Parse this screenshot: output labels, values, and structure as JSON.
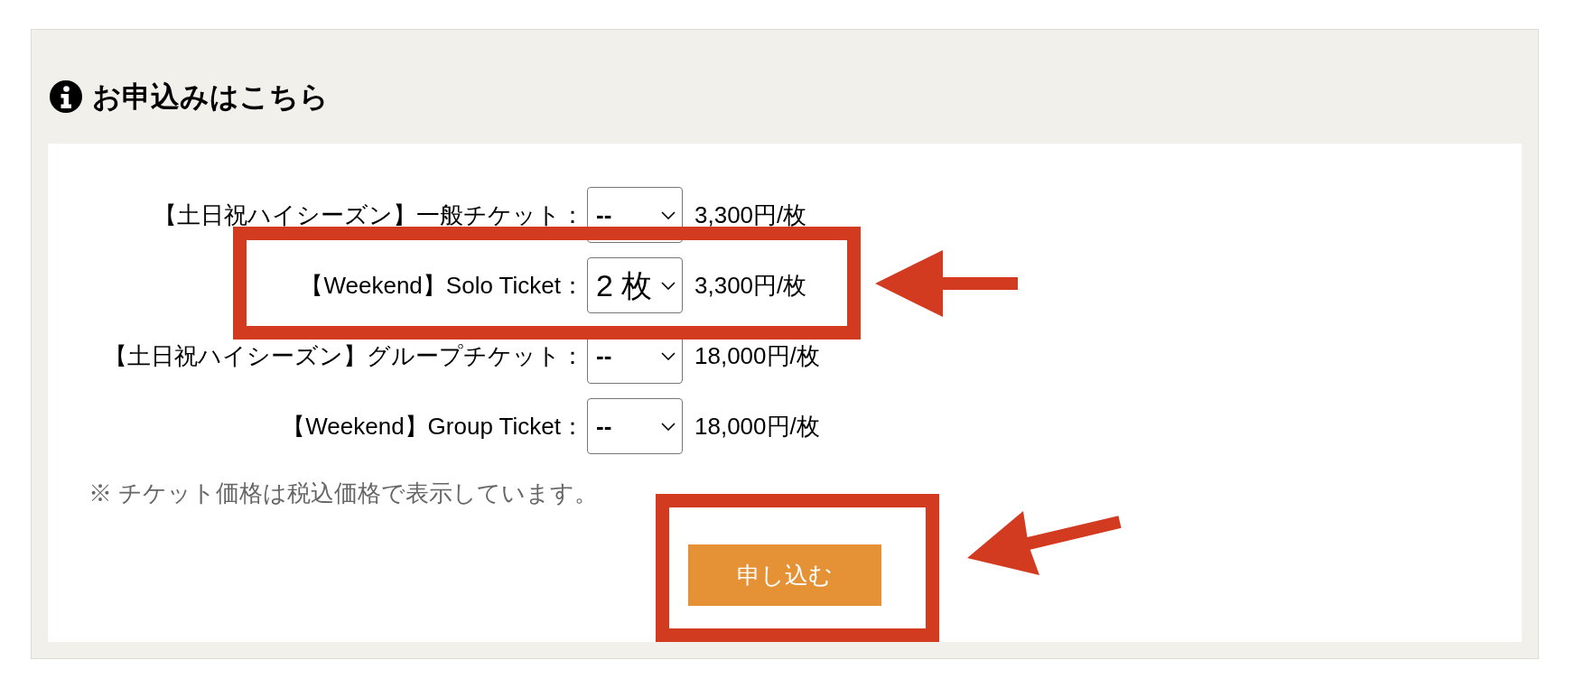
{
  "section": {
    "title": "お申込みはこちら"
  },
  "tickets": [
    {
      "label": "【土日祝ハイシーズン】一般チケット：",
      "quantity": {
        "kind": "placeholder",
        "value": "--"
      },
      "price": "3,300円/枚",
      "highlighted": false
    },
    {
      "label": "【Weekend】Solo Ticket：",
      "quantity": {
        "kind": "picked",
        "value": "2 枚"
      },
      "price": "3,300円/枚",
      "highlighted": true
    },
    {
      "label": "【土日祝ハイシーズン】グループチケット：",
      "quantity": {
        "kind": "placeholder",
        "value": "--"
      },
      "price": "18,000円/枚",
      "highlighted": false
    },
    {
      "label": "【Weekend】Group Ticket：",
      "quantity": {
        "kind": "placeholder",
        "value": "--"
      },
      "price": "18,000円/枚",
      "highlighted": false
    }
  ],
  "note": "※ チケット価格は税込価格で表示しています。",
  "submit": {
    "label": "申し込む",
    "highlighted": true
  }
}
